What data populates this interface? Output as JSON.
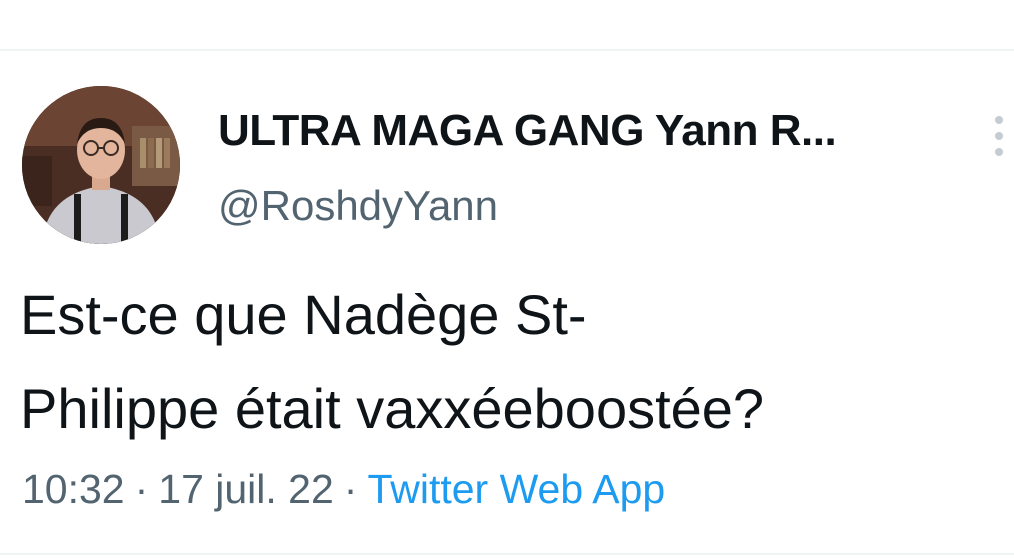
{
  "tweet": {
    "author": {
      "display_name": "ULTRA MAGA GANG Yann R...",
      "handle": "@RoshdyYann"
    },
    "text_lines": [
      "Est-ce que Nadège St-",
      "Philippe était vaxxéeboostée?"
    ],
    "time": "10:32",
    "separator": "·",
    "date": "17 juil. 22",
    "source": "Twitter Web App"
  },
  "icons": {
    "more": "more-vertical-icon"
  },
  "colors": {
    "text": "#0f1419",
    "secondary_text": "#536471",
    "link": "#1d9bf0",
    "divider": "#eff3f4"
  }
}
